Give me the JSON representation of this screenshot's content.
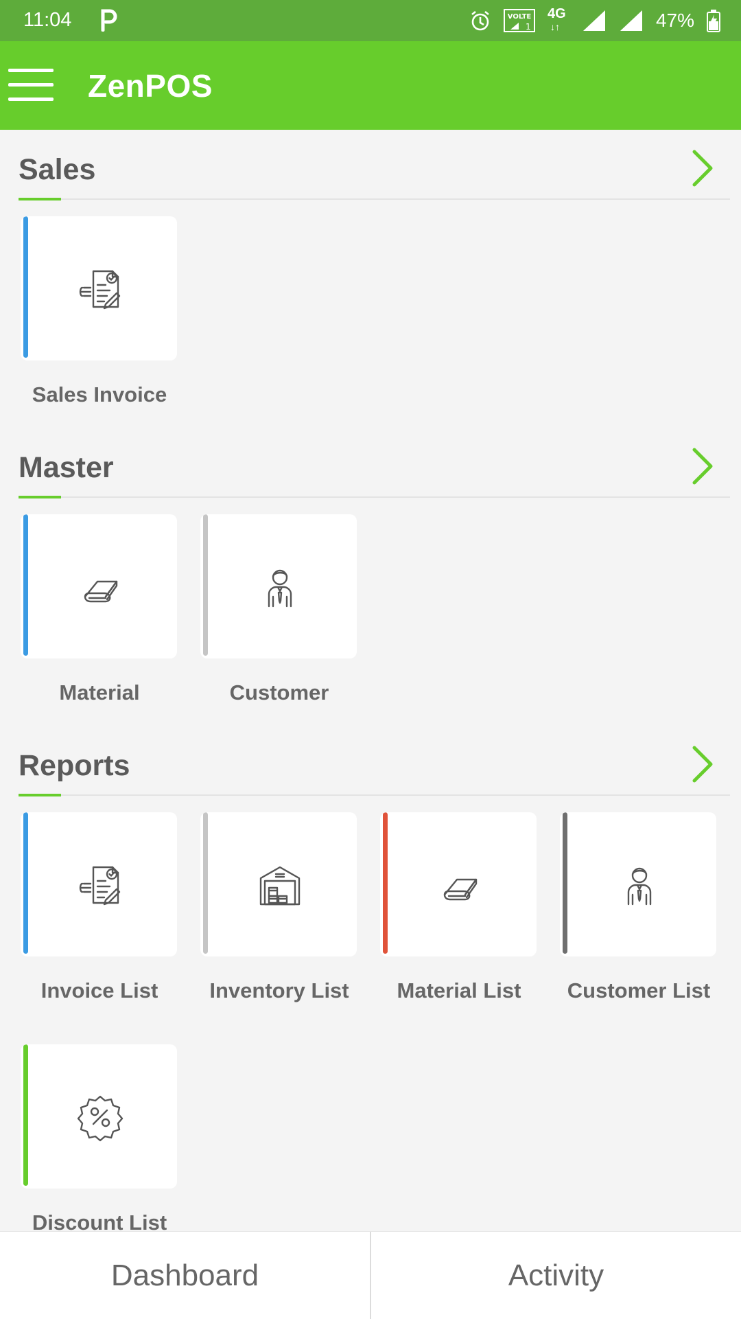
{
  "status_bar": {
    "time": "11:04",
    "network": "4G",
    "volte": "VOLTE",
    "battery": "47%"
  },
  "app_bar": {
    "title": "ZenPOS"
  },
  "sections": [
    {
      "title": "Sales",
      "tiles": [
        {
          "label": "Sales Invoice",
          "icon": "invoice-icon",
          "accent": "#3b9be3"
        }
      ]
    },
    {
      "title": "Master",
      "tiles": [
        {
          "label": "Material",
          "icon": "material-icon",
          "accent": "#3b9be3"
        },
        {
          "label": "Customer",
          "icon": "customer-icon",
          "accent": "#c5c5c5"
        }
      ]
    },
    {
      "title": "Reports",
      "tiles": [
        {
          "label": "Invoice List",
          "icon": "invoice-icon",
          "accent": "#3b9be3"
        },
        {
          "label": "Inventory List",
          "icon": "warehouse-icon",
          "accent": "#c5c5c5"
        },
        {
          "label": "Material List",
          "icon": "material-icon",
          "accent": "#e0533a"
        },
        {
          "label": "Customer List",
          "icon": "customer-icon",
          "accent": "#6f6f6f"
        },
        {
          "label": "Discount List",
          "icon": "discount-icon",
          "accent": "#67cd2c"
        }
      ]
    }
  ],
  "bottom_nav": {
    "tabs": [
      "Dashboard",
      "Activity"
    ]
  },
  "colors": {
    "brand": "#67cd2c",
    "status_bar": "#5eac3b",
    "background": "#f4f4f4"
  }
}
